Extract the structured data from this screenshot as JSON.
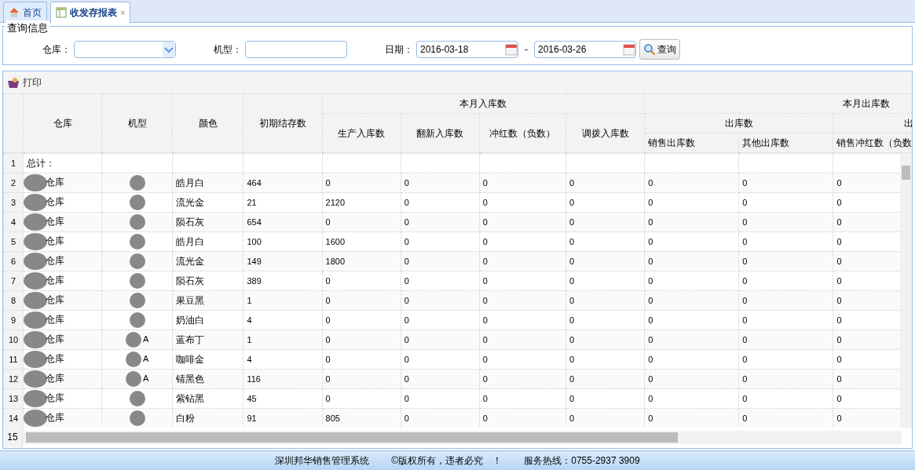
{
  "tabs": [
    {
      "label": "首页",
      "selected": false
    },
    {
      "label": "收发存报表",
      "selected": true,
      "close": "×"
    }
  ],
  "query": {
    "legend": "查询信息",
    "warehouse_label": "仓库：",
    "model_label": "机型：",
    "date_label": "日期：",
    "date_from": "2016-03-18",
    "separator": "-",
    "date_to": "2016-03-26",
    "button": "查询"
  },
  "toolbar": {
    "print": "打印"
  },
  "table": {
    "columns": [
      "仓库",
      "机型",
      "颜色",
      "初期结存数"
    ],
    "groups": [
      "本月入库数",
      "本月出库数"
    ],
    "in_columns": [
      "生产入库数",
      "翻新入库数",
      "冲红数（负数）",
      "调拨入库数"
    ],
    "out_groups": [
      "出库数",
      "出"
    ],
    "out_columns": [
      "销售出库数",
      "其他出库数",
      "销售冲红数（负数"
    ],
    "rows": [
      {
        "num": "1",
        "warehouse": "总计：",
        "redacted": false
      },
      {
        "num": "2",
        "warehouse": "仓库",
        "redacted": true,
        "shade": "皓月白",
        "opening": "464",
        "values": [
          "0",
          "0",
          "0",
          "0",
          "0",
          "0",
          "0"
        ]
      },
      {
        "num": "3",
        "warehouse": "仓库",
        "redacted": true,
        "shade": "流光金",
        "opening": "21",
        "values": [
          "2120",
          "0",
          "0",
          "0",
          "0",
          "0",
          "0"
        ]
      },
      {
        "num": "4",
        "warehouse": "仓库",
        "redacted": true,
        "shade": "陨石灰",
        "opening": "654",
        "values": [
          "0",
          "0",
          "0",
          "0",
          "0",
          "0",
          "0"
        ]
      },
      {
        "num": "5",
        "warehouse": "仓库",
        "redacted": true,
        "shade": "皓月白",
        "opening": "100",
        "values": [
          "1600",
          "0",
          "0",
          "0",
          "0",
          "0",
          "0"
        ]
      },
      {
        "num": "6",
        "warehouse": "仓库",
        "redacted": true,
        "shade": "流光金",
        "opening": "149",
        "values": [
          "1800",
          "0",
          "0",
          "0",
          "0",
          "0",
          "0"
        ]
      },
      {
        "num": "7",
        "warehouse": "仓库",
        "redacted": true,
        "shade": "陨石灰",
        "opening": "389",
        "values": [
          "0",
          "0",
          "0",
          "0",
          "0",
          "0",
          "0"
        ]
      },
      {
        "num": "8",
        "warehouse": "仓库",
        "redacted": true,
        "shade": "果豆黑",
        "opening": "1",
        "values": [
          "0",
          "0",
          "0",
          "0",
          "0",
          "0",
          "0"
        ]
      },
      {
        "num": "9",
        "warehouse": "仓库",
        "redacted": true,
        "shade": "奶油白",
        "opening": "4",
        "values": [
          "0",
          "0",
          "0",
          "0",
          "0",
          "0",
          "0"
        ]
      },
      {
        "num": "10",
        "warehouse": "仓库",
        "redacted": true,
        "model": "A",
        "shade": "蓝布丁",
        "opening": "1",
        "values": [
          "0",
          "0",
          "0",
          "0",
          "0",
          "0",
          "0"
        ]
      },
      {
        "num": "11",
        "warehouse": "仓库",
        "redacted": true,
        "model": "A",
        "shade": "咖啡金",
        "opening": "4",
        "values": [
          "0",
          "0",
          "0",
          "0",
          "0",
          "0",
          "0"
        ]
      },
      {
        "num": "12",
        "warehouse": "仓库",
        "redacted": true,
        "model": "A",
        "shade": "锖黑色",
        "opening": "116",
        "values": [
          "0",
          "0",
          "0",
          "0",
          "0",
          "0",
          "0"
        ]
      },
      {
        "num": "13",
        "warehouse": "仓库",
        "redacted": true,
        "shade": "紫钻黑",
        "opening": "45",
        "values": [
          "0",
          "0",
          "0",
          "0",
          "0",
          "0",
          "0"
        ]
      },
      {
        "num": "14",
        "warehouse": "仓库",
        "redacted": true,
        "shade": "白粉",
        "opening": "91",
        "values": [
          "805",
          "0",
          "0",
          "0",
          "0",
          "0",
          "0"
        ]
      }
    ],
    "partial_row": "15"
  },
  "footer": [
    "深圳邦华销售管理系统",
    "©版权所有，违者必究　！",
    "服务热线：0755-2937 3909"
  ]
}
